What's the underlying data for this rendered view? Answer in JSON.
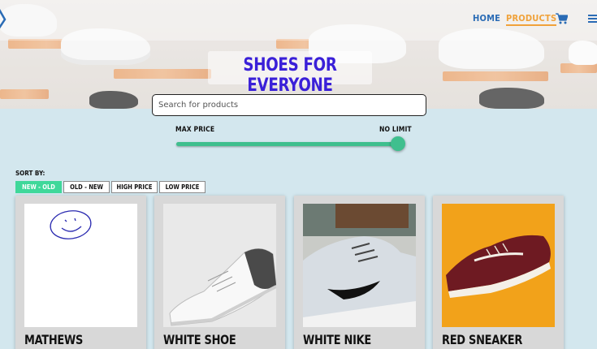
{
  "navbar": {
    "home_label": "HOME",
    "products_label": "PRODUCTS"
  },
  "hero": {
    "title": "SHOES FOR EVERYONE"
  },
  "search": {
    "placeholder": "Search for products",
    "value": ""
  },
  "price_filter": {
    "min_label": "MAX PRICE",
    "max_label": "NO LIMIT",
    "slider_level": 1.0
  },
  "sort": {
    "label": "SORT BY:",
    "options": [
      "NEW - OLD",
      "OLD - NEW",
      "HIGH PRICE",
      "LOW PRICE"
    ],
    "selected": "NEW - OLD"
  },
  "products": [
    {
      "name": "MATHEWS"
    },
    {
      "name": "WHITE SHOE"
    },
    {
      "name": "WHITE NIKE"
    },
    {
      "name": "RED SNEAKER"
    }
  ],
  "colors": {
    "accent": "#3fbf8e",
    "nav_link": "#2a6bb5",
    "nav_active": "#f0a23a",
    "hero_title": "#3a20d8",
    "page_bg": "#d3e7ee"
  }
}
